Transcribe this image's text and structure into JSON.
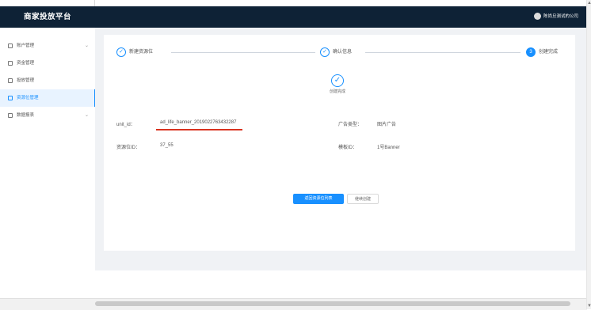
{
  "app": {
    "title": "商家投放平台"
  },
  "header": {
    "user_name": "陈尚旦测试的公司"
  },
  "sidebar": {
    "items": [
      {
        "label": "账户管理",
        "has_children": true
      },
      {
        "label": "资金管理",
        "has_children": false
      },
      {
        "label": "投放管理",
        "has_children": false
      },
      {
        "label": "资源位管理",
        "has_children": false,
        "active": true
      },
      {
        "label": "数据报表",
        "has_children": true
      }
    ]
  },
  "steps": [
    {
      "number": "1",
      "label": "新建资源位",
      "state": "done"
    },
    {
      "number": "2",
      "label": "确认信息",
      "state": "done"
    },
    {
      "number": "3",
      "label": "创建完成",
      "state": "current"
    }
  ],
  "result": {
    "status_label": "创建完成"
  },
  "fields": {
    "unit_id_label": "unit_id：",
    "unit_id_value": "ad_life_banner_2019022763432287",
    "ad_type_label": "广告类型：",
    "ad_type_value": "图片广告",
    "resource_id_label": "资源位ID：",
    "resource_id_value": "37_55",
    "template_id_label": "模板ID：",
    "template_id_value": "1号Banner"
  },
  "actions": {
    "back_label": "返回资源位列表",
    "continue_label": "继续创建"
  },
  "colors": {
    "accent": "#1890ff",
    "header_bg": "#0e2236",
    "underline": "#d9321f"
  }
}
